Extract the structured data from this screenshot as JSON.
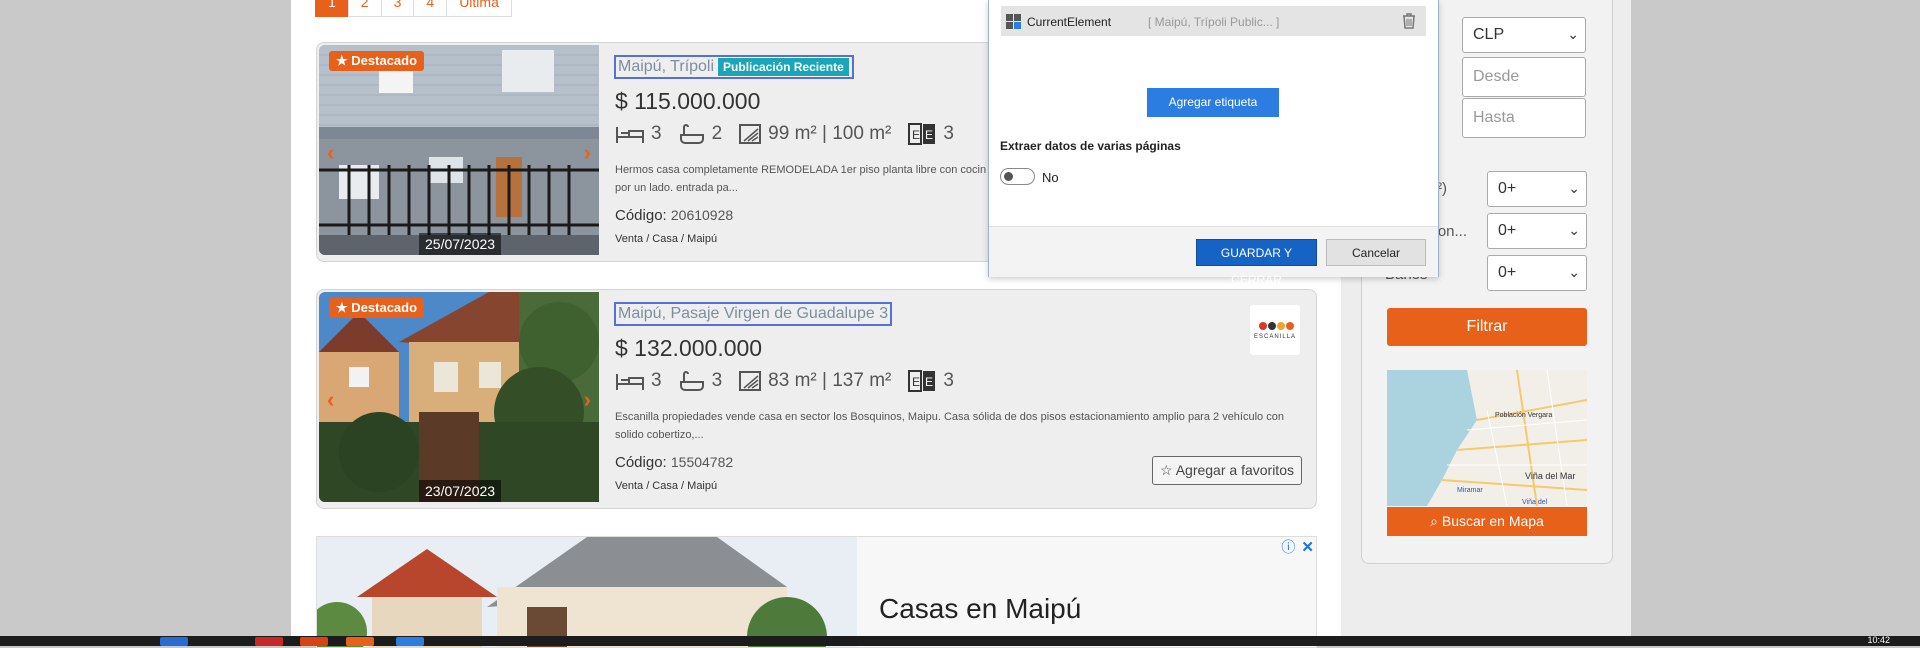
{
  "pagination": {
    "pages": [
      "1",
      "2",
      "3",
      "4"
    ],
    "last_label": "Última"
  },
  "listings": [
    {
      "featured": "Destacado",
      "title": "Maipú, Trípoli",
      "badge": "Publicación Reciente",
      "price": "$ 115.000.000",
      "bedrooms": "3",
      "bathrooms": "2",
      "area": "99 m² | 100 m²",
      "parking": "3",
      "description_line1": "Hermos casa completamente REMODELADA 1er piso planta libre con cocin",
      "description_line2": "por un lado. entrada pa...",
      "code_label": "Código:",
      "code": "20610928",
      "breadcrumb": "Venta / Casa / Maipú",
      "date": "25/07/2023"
    },
    {
      "featured": "Destacado",
      "title": "Maipú, Pasaje Virgen de Guadalupe 3",
      "price": "$ 132.000.000",
      "bedrooms": "3",
      "bathrooms": "3",
      "area": "83 m² | 137 m²",
      "parking": "3",
      "description_line1": "Escanilla propiedades vende casa en sector los Bosquinos, Maipu. Casa sólida de dos pisos estacionamiento amplio para 2 vehículo con",
      "description_line2": "solido cobertizo,...",
      "code_label": "Código:",
      "code": "15504782",
      "breadcrumb": "Venta / Casa / Maipú",
      "date": "23/07/2023",
      "agency": "ESCANILLA",
      "favorite_button": "Agregar a favoritos"
    }
  ],
  "ad": {
    "headline": "Casas en Maipú"
  },
  "filters": {
    "currency": "CLP",
    "price_from_placeholder": "Desde",
    "price_to_placeholder": "Hasta",
    "label_surface": "²)",
    "label_parking": "cion...",
    "label_bathrooms": "Baños",
    "surface_value": "0+",
    "parking_value": "0+",
    "bathrooms_value": "0+",
    "filter_button": "Filtrar",
    "map_button": "Buscar en Mapa",
    "map_labels": [
      "Población Vergara",
      "Viña del Mar",
      "Miramar",
      "Viña del"
    ]
  },
  "dialog": {
    "element_name": "CurrentElement",
    "element_preview": "[ Maipú, Trípoli Public... ]",
    "add_label_button": "Agregar etiqueta",
    "multi_page_label": "Extraer datos de varias páginas",
    "toggle_value": "No",
    "save_button": "GUARDAR Y CERRAR",
    "cancel_button": "Cancelar"
  },
  "taskbar": {
    "clock": "10:42"
  },
  "colors": {
    "accent": "#e8611a",
    "badge": "#1aa5b8",
    "primary_blue": "#1563c4"
  }
}
